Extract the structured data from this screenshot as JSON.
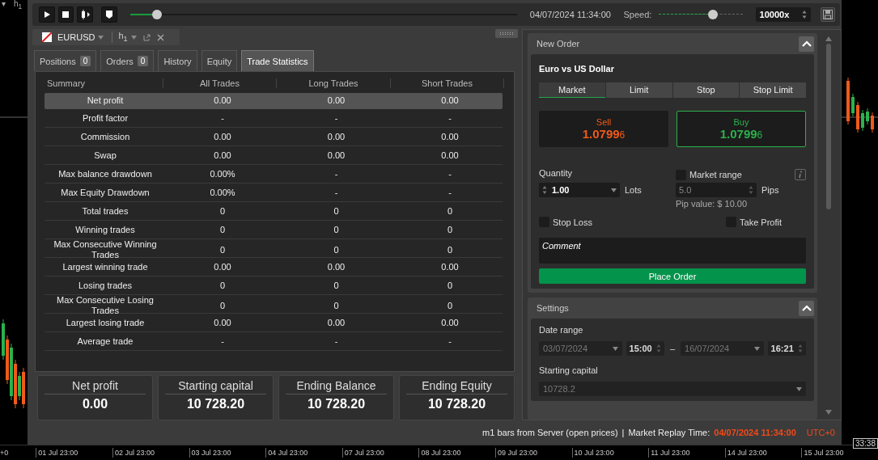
{
  "chart_header": {
    "menu_glyph": "▾",
    "timeframe": "h$_{1}$"
  },
  "toolbar": {
    "progress": {
      "level": 0.07
    },
    "datetime": "04/07/2024 11:34:00",
    "speed_label": "Speed:",
    "speed": {
      "level": 0.65
    },
    "speed_value": "10000x"
  },
  "chart_tab": {
    "symbol": "EURUSD",
    "timeframe": "h$_{1}$"
  },
  "tabs": [
    {
      "label": "Positions",
      "count": "0",
      "selected": false
    },
    {
      "label": "Orders",
      "count": "0",
      "selected": false
    },
    {
      "label": "History",
      "selected": false
    },
    {
      "label": "Equity",
      "selected": false
    },
    {
      "label": "Trade Statistics",
      "selected": true
    }
  ],
  "table": {
    "columns": [
      "Summary",
      "All Trades",
      "Long Trades",
      "Short Trades"
    ],
    "rows": [
      {
        "cells": [
          "Net profit",
          "0.00",
          "0.00",
          "0.00"
        ],
        "selected": true
      },
      {
        "cells": [
          "Profit factor",
          "-",
          "-",
          "-"
        ],
        "selected": false
      },
      {
        "cells": [
          "Commission",
          "0.00",
          "0.00",
          "0.00"
        ],
        "selected": false
      },
      {
        "cells": [
          "Swap",
          "0.00",
          "0.00",
          "0.00"
        ],
        "selected": false
      },
      {
        "cells": [
          "Max balance drawdown",
          "0.00%",
          "-",
          "-"
        ],
        "selected": false
      },
      {
        "cells": [
          "Max Equity Drawdown",
          "0.00%",
          "-",
          "-"
        ],
        "selected": false
      },
      {
        "cells": [
          "Total trades",
          "0",
          "0",
          "0"
        ],
        "selected": false
      },
      {
        "cells": [
          "Winning trades",
          "0",
          "0",
          "0"
        ],
        "selected": false
      },
      {
        "cells": [
          "Max Consecutive Winning Trades",
          "0",
          "0",
          "0"
        ],
        "selected": false
      },
      {
        "cells": [
          "Largest winning trade",
          "0.00",
          "0.00",
          "0.00"
        ],
        "selected": false
      },
      {
        "cells": [
          "Losing trades",
          "0",
          "0",
          "0"
        ],
        "selected": false
      },
      {
        "cells": [
          "Max Consecutive Losing Trades",
          "0",
          "0",
          "0"
        ],
        "selected": false
      },
      {
        "cells": [
          "Largest losing trade",
          "0.00",
          "0.00",
          "0.00"
        ],
        "selected": false
      },
      {
        "cells": [
          "Average trade",
          "-",
          "-",
          "-"
        ],
        "selected": false
      }
    ]
  },
  "summary_cards": [
    {
      "label": "Net profit",
      "value": "0.00"
    },
    {
      "label": "Starting capital",
      "value": "10 728.20"
    },
    {
      "label": "Ending Balance",
      "value": "10 728.20"
    },
    {
      "label": "Ending Equity",
      "value": "10 728.20"
    }
  ],
  "new_order": {
    "title": "New Order",
    "expanded": true,
    "symbol_name": "Euro vs US Dollar",
    "order_types": [
      {
        "label": "Market",
        "selected": true
      },
      {
        "label": "Limit",
        "selected": false
      },
      {
        "label": "Stop",
        "selected": false
      },
      {
        "label": "Stop Limit",
        "selected": false
      }
    ],
    "sides": [
      {
        "kind": "sell",
        "label": "Sell",
        "price": "1.0799",
        "pipette": "6",
        "selected": false
      },
      {
        "kind": "buy",
        "label": "Buy",
        "price": "1.0799",
        "pipette": "6",
        "selected": true
      }
    ],
    "quantity_label": "Quantity",
    "quantity": "1.00",
    "quantity_unit": "Lots",
    "market_range": {
      "label": "Market range",
      "checked": false
    },
    "pips": "5.0",
    "pips_unit": "Pips",
    "pip_value": "Pip value: $ 10.00",
    "stop_loss": {
      "label": "Stop Loss",
      "checked": false
    },
    "take_profit": {
      "label": "Take Profit",
      "checked": false
    },
    "comment_placeholder": "Comment",
    "submit": "Place Order"
  },
  "settings": {
    "title": "Settings",
    "expanded": true,
    "date_range_label": "Date range",
    "start_date": "03/07/2024",
    "start_time": "15:00",
    "separator": "–",
    "end_date": "16/07/2024",
    "end_time": "16:21",
    "capital_label": "Starting capital",
    "capital": "10728.2"
  },
  "status_bar": {
    "source": "m1 bars from Server (open prices)",
    "separator": "|",
    "replay_label": "Market Replay Time:",
    "replay_time": "04/07/2024 11:34:00",
    "timezone": "UTC+0"
  },
  "time_axis": {
    "offset": "+0",
    "labels": [
      "01 Jul 23:00",
      "02 Jul 23:00",
      "03 Jul 23:00",
      "04 Jul 23:00",
      "07 Jul 23:00",
      "08 Jul 23:00",
      "09 Jul 23:00",
      "10 Jul 23:00",
      "11 Jul 23:00",
      "14 Jul 23:00",
      "15 Jul 23:00"
    ],
    "cursor_time": "33:38"
  }
}
